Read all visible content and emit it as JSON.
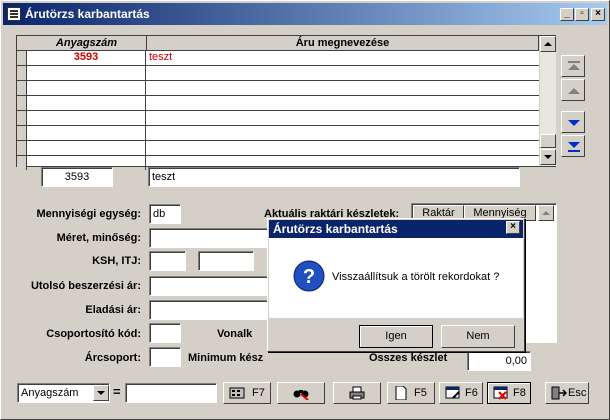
{
  "window": {
    "title": "Árutörzs karbantartás",
    "controls": [
      "minimize",
      "restore",
      "close"
    ]
  },
  "grid": {
    "columns": [
      "Anyagszám",
      "Áru megnevezése"
    ],
    "rows": [
      {
        "code": "3593",
        "name": "teszt"
      },
      {
        "code": "",
        "name": ""
      },
      {
        "code": "",
        "name": ""
      },
      {
        "code": "",
        "name": ""
      },
      {
        "code": "",
        "name": ""
      },
      {
        "code": "",
        "name": ""
      },
      {
        "code": "",
        "name": ""
      },
      {
        "code": "",
        "name": ""
      }
    ],
    "code_color": "#d00000"
  },
  "current": {
    "code": "3593",
    "name": "teszt"
  },
  "form": {
    "unit_label": "Mennyiségi egység:",
    "unit_value": "db",
    "size_label": "Méret, minőség:",
    "size_value": "",
    "ksh_label": "KSH, ITJ:",
    "last_price_label": "Utolsó beszerzési ár:",
    "sale_price_label": "Eladási ár:",
    "group_code_label": "Csoportosító kód:",
    "barcode_label": "Vonalk",
    "price_group_label": "Árcsoport:",
    "min_stock_label": "Minimum kész",
    "total_stock_label": "Összes készlet",
    "total_stock_value": "0,00",
    "stock_title": "Aktuális raktári készletek:",
    "stock_columns": [
      "Raktár",
      "Mennyiség"
    ]
  },
  "search": {
    "field": "Anyagszám",
    "equals": "=",
    "value": ""
  },
  "buttons": {
    "f7": "F7",
    "f5": "F5",
    "f6": "F6",
    "f8": "F8",
    "esc": "Esc"
  },
  "dialog": {
    "title": "Árutörzs karbantartás",
    "message": "Visszaállítsuk a törölt rekordokat ?",
    "yes": "Igen",
    "no": "Nem",
    "icon": "question-icon"
  }
}
